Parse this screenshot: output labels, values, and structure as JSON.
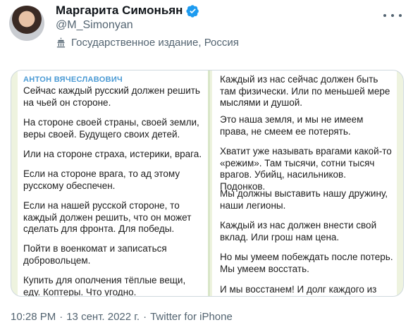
{
  "author": {
    "display_name": "Маргарита Симоньян",
    "handle": "@M_Simonyan",
    "label": "Государственное издание, Россия"
  },
  "media": {
    "left": {
      "sender": "АНТОН ВЯЧЕСЛАВОВИЧ",
      "paragraphs": [
        "Сейчас каждый русский должен решить на чьей он стороне.",
        "На стороне своей страны, своей земли, веры своей. Будущего своих детей.",
        "Или на стороне страха, истерики, врага.",
        "Если на стороне врага, то ад этому русскому обеспечен.",
        "Если на нашей русской стороне, то каждый должен решить, что он может сделать для фронта. Для победы.",
        "Пойти в военкомат и записаться добровольцем.",
        "Купить для ополчения тёплые вещи, еду. Коптеры. Что угодно."
      ]
    },
    "right": {
      "paragraphs": [
        "Каждый из нас сейчас должен быть там физически. Или по меньшей мере мыслями и душой.",
        "Это наша земля, и мы не имеем права, не смеем ее потерять.",
        "Хватит уже называть врагами какой-то «режим». Там тысячи, сотни тысяч врагов. Убийц, насильников. Подонков.",
        "Мы должны выставить нашу дружину, наши легионы.",
        "Каждый из нас должен внести свой вклад. Или грош нам цена.",
        "Но мы умеем побеждать после потерь. Мы умеем восстать.",
        "И мы восстанем! И долг каждого из нас помочь. Вместе победить!"
      ]
    }
  },
  "footer": {
    "time": "10:28 PM",
    "sep1": "·",
    "date": "13 сент. 2022 г.",
    "sep2": "·",
    "source": "Twitter for iPhone"
  },
  "colors": {
    "verified": "#1d9bf0",
    "secondary_text": "#536471",
    "sender": "#4a9ad4"
  }
}
